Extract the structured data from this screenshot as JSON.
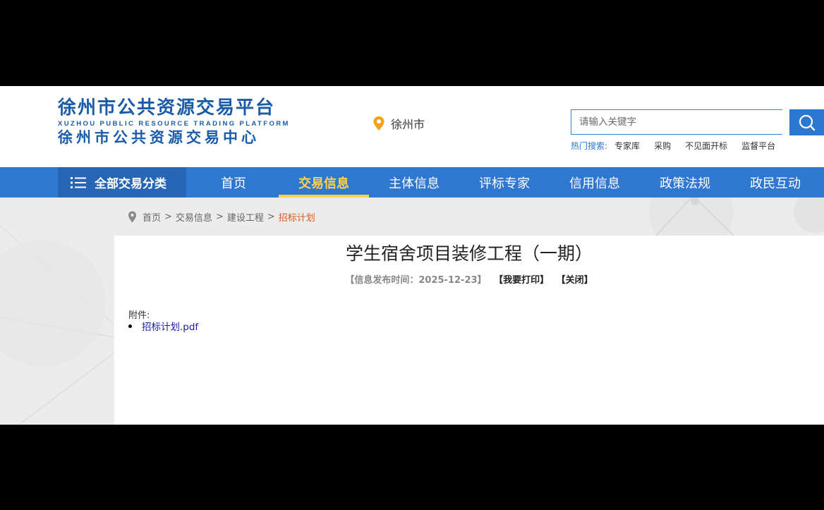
{
  "header": {
    "logo_title": "徐州市公共资源交易平台",
    "logo_subtitle_en": "XUZHOU PUBLIC RESOURCE TRADING PLATFORM",
    "logo_center": "徐州市公共资源交易中心",
    "city": "徐州市",
    "search": {
      "placeholder": "请输入关键字",
      "value": ""
    },
    "hot_label": "热门搜索:",
    "hot_items": [
      "专家库",
      "采购",
      "不见面开标",
      "监督平台"
    ]
  },
  "nav": {
    "all_categories": "全部交易分类",
    "items": [
      "首页",
      "交易信息",
      "主体信息",
      "评标专家",
      "信用信息",
      "政策法规",
      "政民互动"
    ],
    "active": "交易信息"
  },
  "breadcrumb": {
    "items": [
      "首页",
      "交易信息",
      "建设工程"
    ],
    "current": "招标计划",
    "separator": ">"
  },
  "article": {
    "title": "学生宿舍项目装修工程（一期）",
    "publish": "【信息发布时间：2025-12-23】",
    "print": "【我要打印】",
    "close": "【关闭】",
    "attachment_label": "附件:",
    "attachments": [
      "招标计划.pdf"
    ]
  },
  "colors": {
    "brand_blue": "#2f77cf",
    "active_yellow": "#ffd24c",
    "breadcrumb_current": "#e2571d"
  }
}
